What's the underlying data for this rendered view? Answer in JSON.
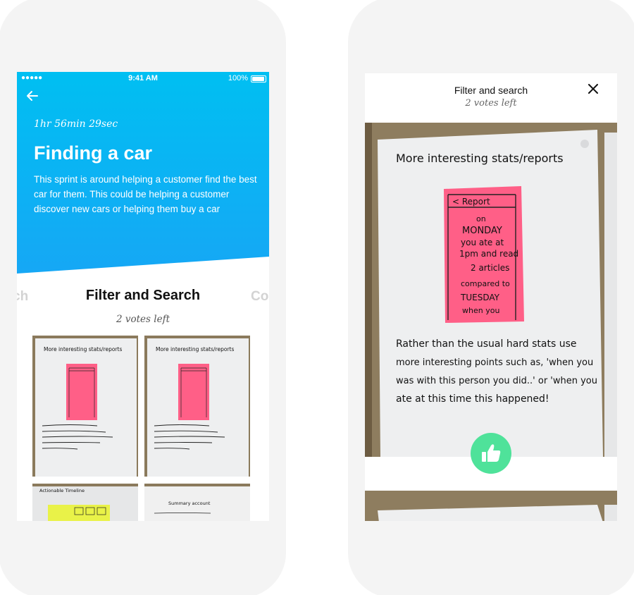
{
  "left_screen": {
    "status_bar": {
      "signal": "●●●●●",
      "time": "9:41 AM",
      "battery": "100%"
    },
    "back_icon": "arrow-left-icon",
    "hero": {
      "timer": "1hr 56min 29sec",
      "title": "Finding a car",
      "description": "This sprint is around helping a customer find the best car for them. This could be helping a customer discover new cars or helping them buy a car",
      "gradient_top": "#00bff2",
      "gradient_bottom": "#17a6f5"
    },
    "carousel": {
      "prev_label": "ch",
      "title": "Filter and Search",
      "next_label": "Co",
      "votes_left": "2 votes left"
    },
    "thumbnails": [
      {
        "heading": "More interesting stats/reports"
      },
      {
        "heading": "More interesting stats/reports"
      },
      {
        "heading": "Actionable Timeline"
      },
      {
        "heading": "Summary account"
      }
    ]
  },
  "right_screen": {
    "title": "Filter and search",
    "votes_left": "2 votes left",
    "close_icon": "close-icon",
    "photo": {
      "heading": "More interesting stats/reports",
      "sticky_note": {
        "header": "< Report",
        "lines": [
          "on",
          "MONDAY",
          "you ate at",
          "1pm and read",
          "2 articles",
          "compared to",
          "TUESDAY",
          "when you"
        ],
        "color": "#ff5f87"
      },
      "body_lines": [
        "Rather than the usual hard stats use",
        "more interesting points such as, 'when you",
        "was with this person you did..' or 'when you",
        "ate at this time this happened!"
      ]
    },
    "like_button": {
      "icon": "thumbs-up-icon",
      "color": "#4fe29a"
    }
  }
}
